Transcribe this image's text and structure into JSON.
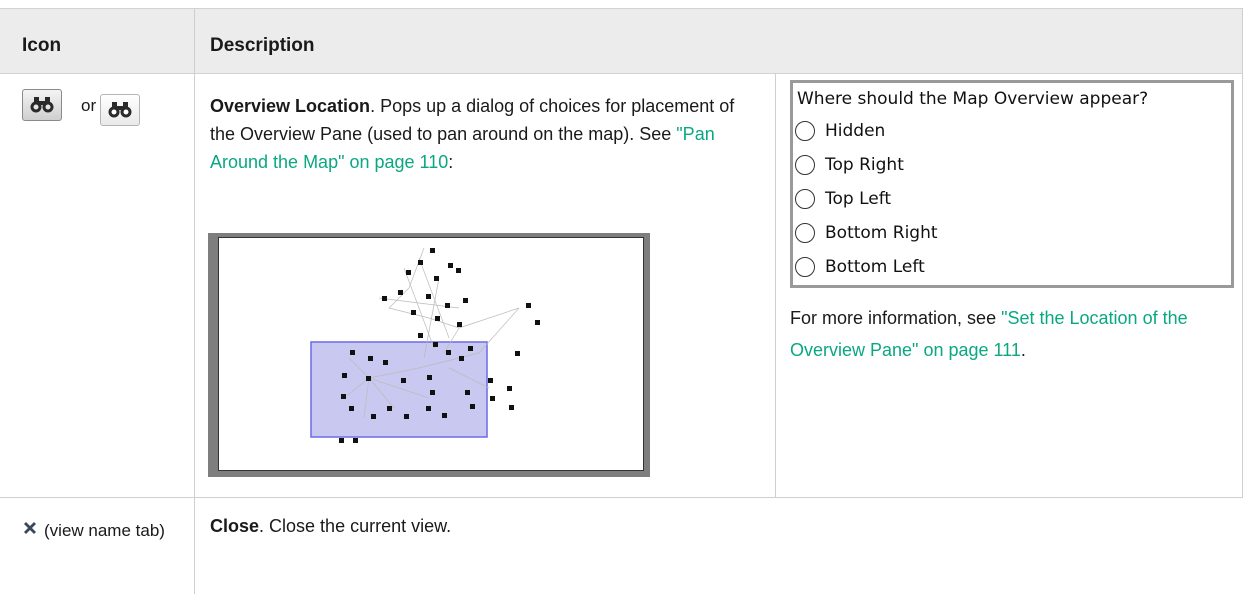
{
  "header": {
    "icon_col": "Icon",
    "desc_col": "Description"
  },
  "row1": {
    "or_text": "or",
    "title": "Overview Location",
    "desc_after_title": ". Pops up a dialog of choices for placement of the Overview Pane (used to pan around on the map). See ",
    "link_text": "\"Pan Around the Map\" on page 110",
    "desc_end": ":",
    "dialog": {
      "question": "Where should the Map Overview appear?",
      "options": [
        "Hidden",
        "Top Right",
        "Top Left",
        "Bottom Right",
        "Bottom Left"
      ]
    },
    "more_prefix": "For more information, see ",
    "more_link": "\"Set the Location of the Overview Pane\" on page 111",
    "more_end": ".",
    "icons": [
      "binoculars-icon-active",
      "binoculars-icon"
    ]
  },
  "row2": {
    "icon_label": "(view name tab)",
    "title": "Close",
    "desc": ". Close the current view.",
    "icon": "close-x-icon"
  },
  "colors": {
    "link": "#0aa882",
    "header_bg": "#ececec",
    "overview_selection": "#c8c8f0"
  }
}
